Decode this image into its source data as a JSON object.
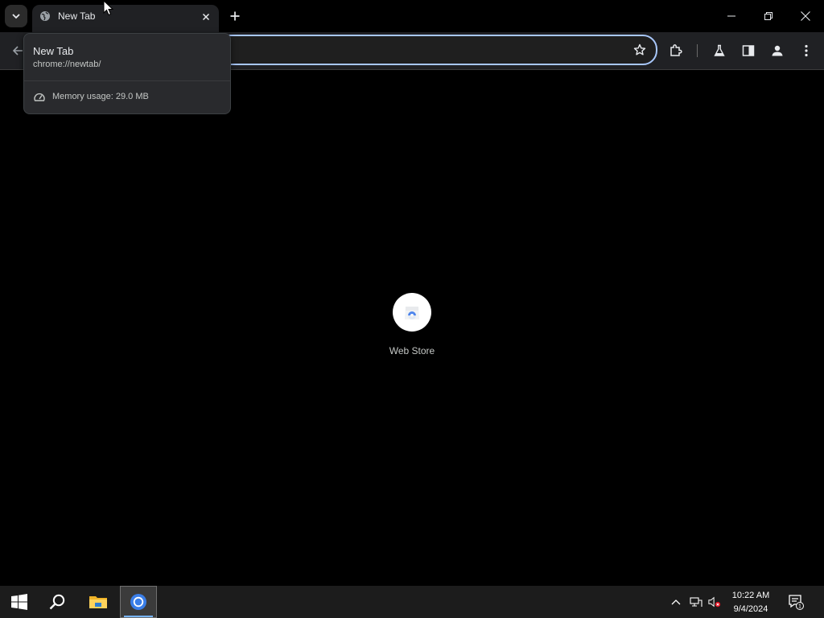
{
  "browser": {
    "active_tab": {
      "title": "New Tab",
      "favicon": "globe-icon"
    },
    "hovercard": {
      "title": "New Tab",
      "url": "chrome://newtab/",
      "memory": "Memory usage: 29.0 MB"
    },
    "omnibox": {
      "value": ""
    },
    "toolbar_icons": [
      "back-arrow-icon",
      "star-icon",
      "extensions-icon",
      "labs-flask-icon",
      "side-panel-icon",
      "profile-icon",
      "more-menu-icon"
    ],
    "window_controls": [
      "minimize-icon",
      "restore-icon",
      "close-icon"
    ]
  },
  "newtab": {
    "shortcuts": [
      {
        "label": "Web Store",
        "icon": "web-store-icon"
      }
    ]
  },
  "taskbar": {
    "apps": [
      "start-icon",
      "search-icon",
      "file-explorer-icon",
      "chrome-icon"
    ],
    "tray": [
      "chevron-up-icon",
      "network-icon",
      "volume-muted-icon"
    ],
    "time": "10:22 AM",
    "date": "9/4/2024",
    "notifications_count": "1"
  },
  "colors": {
    "accent": "#a8c7fa",
    "tab_bg": "#202124",
    "page_bg": "#000000",
    "taskbar_bg": "#1c1c1c"
  }
}
